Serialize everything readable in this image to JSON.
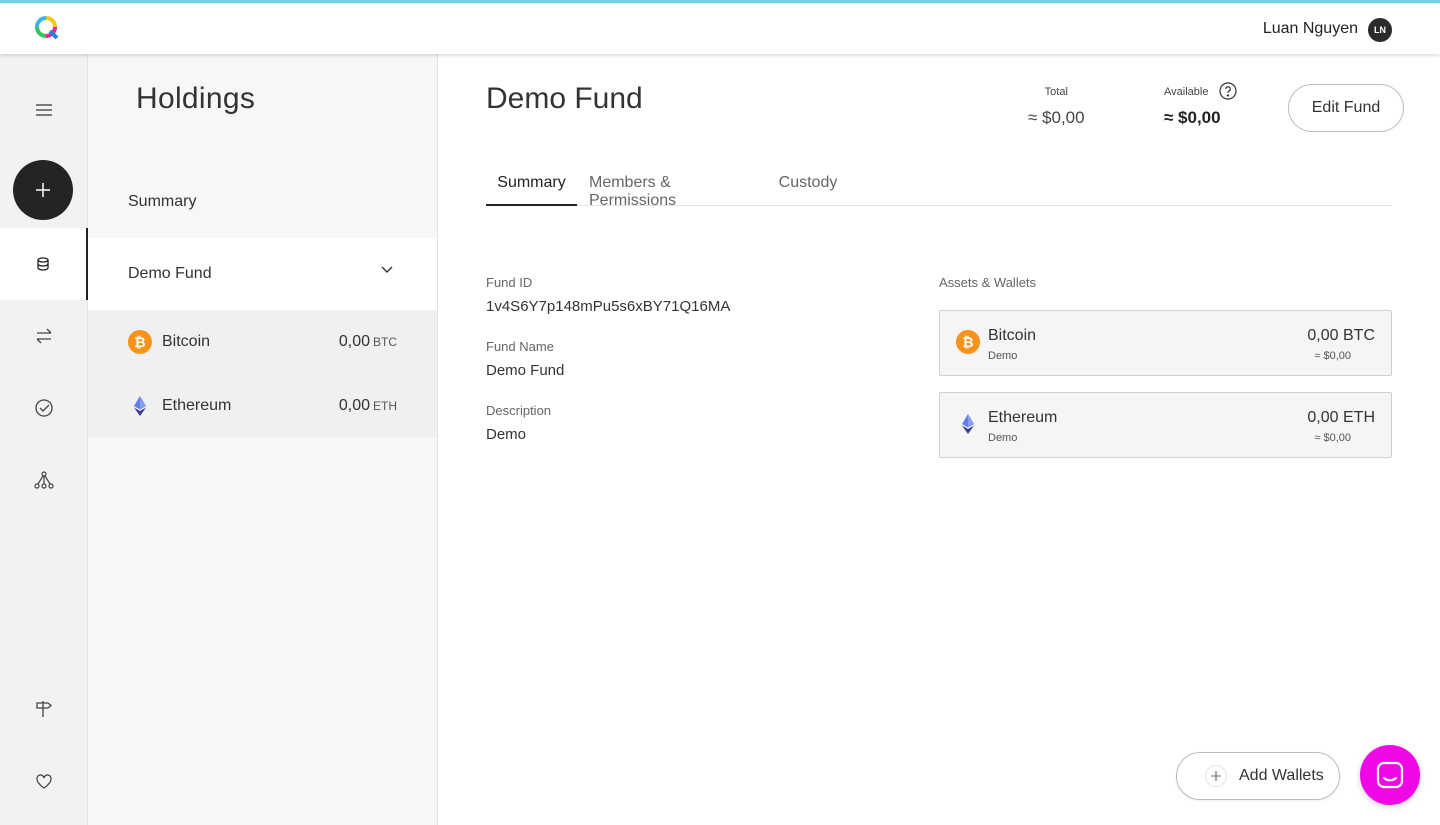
{
  "header": {
    "logo_icon": "q-logo-icon",
    "user_name": "Luan Nguyen",
    "avatar_initials": "LN"
  },
  "rail": {
    "items": [
      {
        "icon": "menu-icon"
      },
      {
        "icon": "plus-icon"
      },
      {
        "icon": "database-icon",
        "active": true
      },
      {
        "icon": "transfer-arrows-icon"
      },
      {
        "icon": "check-circle-icon"
      },
      {
        "icon": "network-icon"
      },
      {
        "icon": "signpost-icon"
      },
      {
        "icon": "heart-icon"
      }
    ]
  },
  "holdings": {
    "title": "Holdings",
    "summary_label": "Summary",
    "fund_label": "Demo Fund",
    "assets": [
      {
        "name": "Bitcoin",
        "amount": "0,00",
        "unit": "BTC",
        "icon": "bitcoin-icon"
      },
      {
        "name": "Ethereum",
        "amount": "0,00",
        "unit": "ETH",
        "icon": "ethereum-icon"
      }
    ]
  },
  "main": {
    "title": "Demo Fund",
    "total_label": "Total",
    "total_value": "≈ $0,00",
    "available_label": "Available",
    "available_value": "≈ $0,00",
    "edit_button": "Edit Fund",
    "tabs": [
      {
        "label": "Summary",
        "active": true
      },
      {
        "label": "Members & Permissions"
      },
      {
        "label": "Custody"
      }
    ],
    "fields": {
      "fund_id_label": "Fund ID",
      "fund_id_value": "1v4S6Y7p148mPu5s6xBY71Q16MA",
      "fund_name_label": "Fund Name",
      "fund_name_value": "Demo Fund",
      "description_label": "Description",
      "description_value": "Demo"
    },
    "assets_wallets_label": "Assets & Wallets",
    "wallets": [
      {
        "name": "Bitcoin",
        "sub": "Demo",
        "amount": "0,00 BTC",
        "fiat": "≈ $0,00",
        "icon": "bitcoin-icon"
      },
      {
        "name": "Ethereum",
        "sub": "Demo",
        "amount": "0,00 ETH",
        "fiat": "≈ $0,00",
        "icon": "ethereum-icon"
      }
    ],
    "add_wallets_label": "Add Wallets"
  },
  "chat": {
    "icon": "chat-icon"
  },
  "colors": {
    "accent_top": "#6fd3e8",
    "bitcoin": "#f7931a",
    "ethereum": "#627eea",
    "chat_button": "#f007e6"
  }
}
